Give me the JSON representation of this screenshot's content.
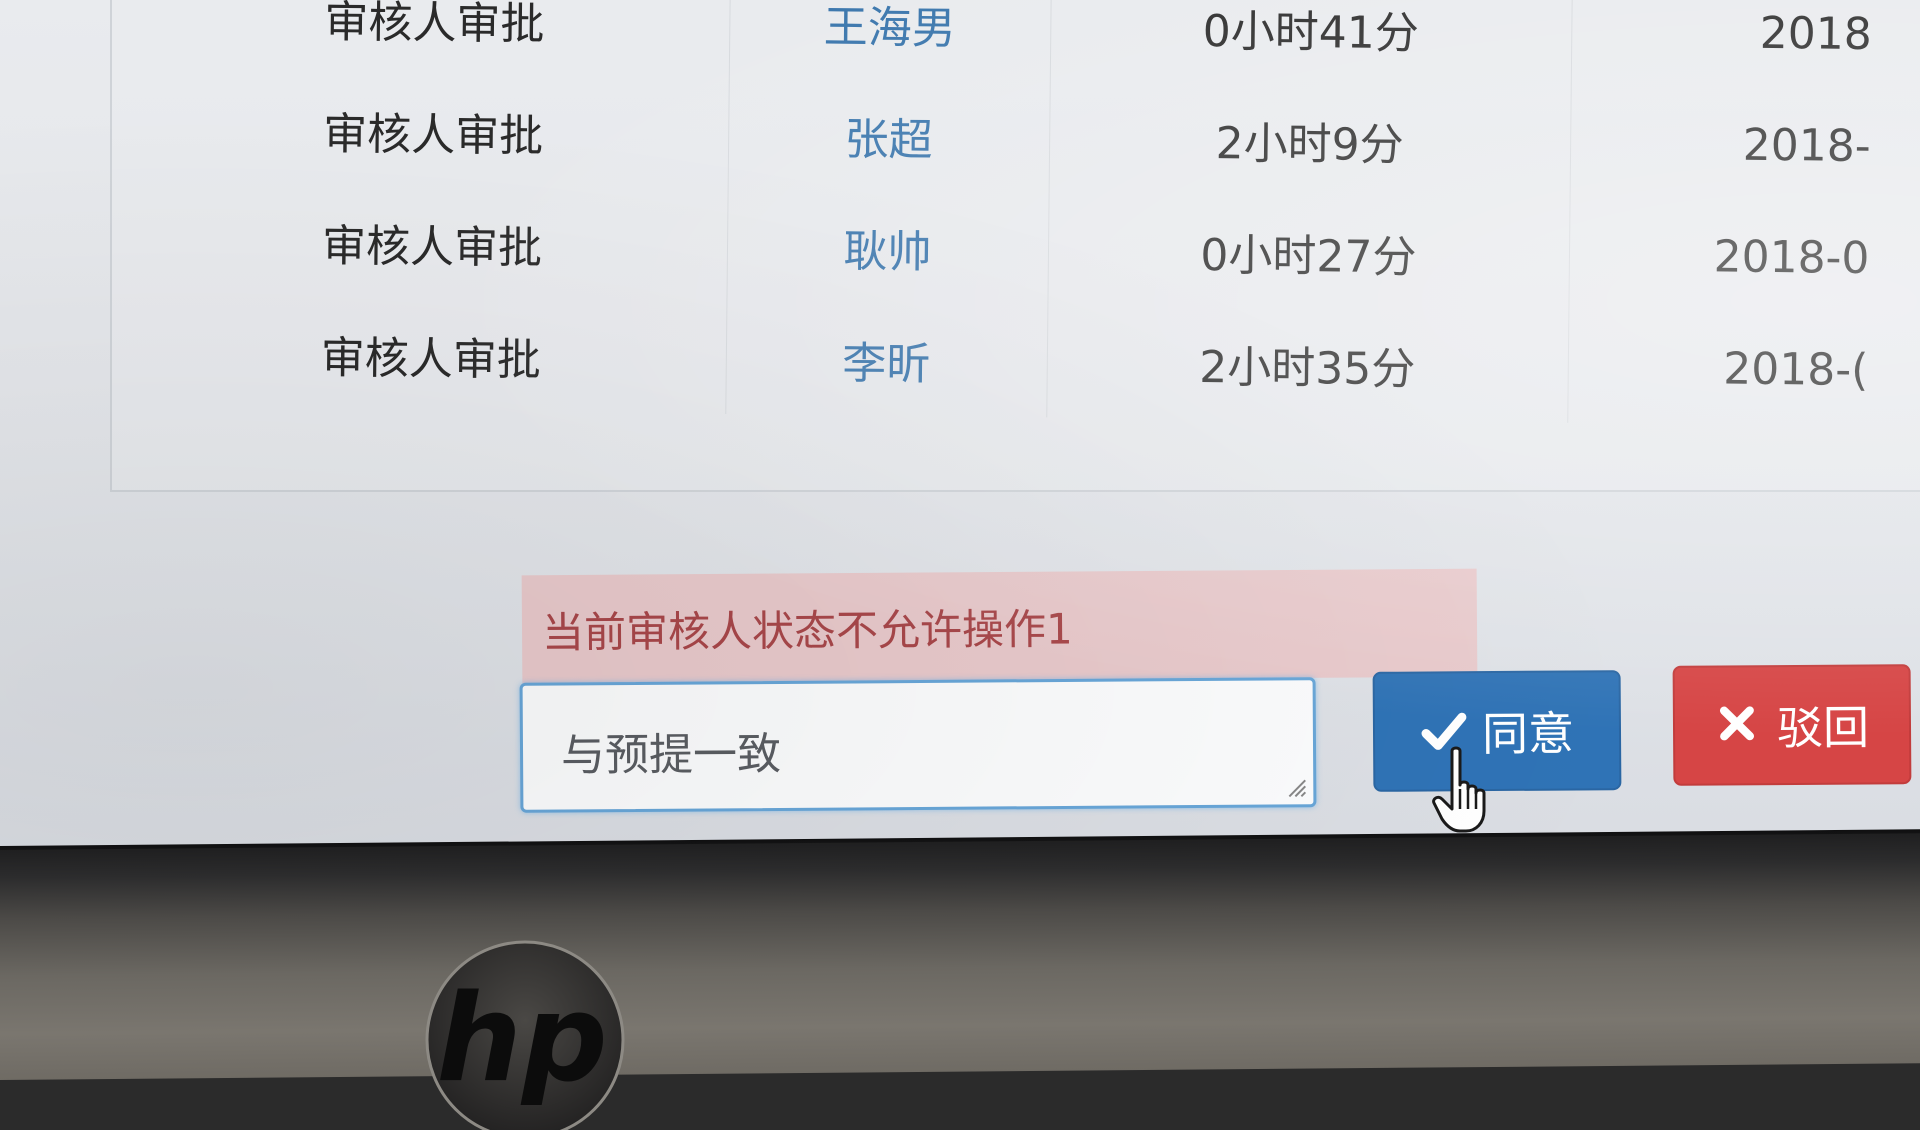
{
  "approval_rows": [
    {
      "step": "审核人审批",
      "user": "王海男",
      "duration": "0小时41分",
      "date": "2018"
    },
    {
      "step": "审核人审批",
      "user": "张超",
      "duration": "2小时9分",
      "date": "2018-"
    },
    {
      "step": "审核人审批",
      "user": "耿帅",
      "duration": "0小时27分",
      "date": "2018-0"
    },
    {
      "step": "审核人审批",
      "user": "李昕",
      "duration": "2小时35分",
      "date": "2018-("
    }
  ],
  "alert": {
    "message": "当前审核人状态不允许操作1"
  },
  "comment": {
    "value": "与预提一致"
  },
  "actions": {
    "approve_label": "同意",
    "reject_label": "驳回"
  },
  "colors": {
    "approve": "#2f73b6",
    "reject": "#d64545",
    "alert_bg": "#e8c9cb",
    "alert_text": "#a8474a",
    "link": "#3c77ad"
  },
  "icons": {
    "approve": "check-icon",
    "reject": "x-icon",
    "cursor": "hand-pointer-icon",
    "logo": "hp-logo"
  },
  "device": {
    "logo_text": "hp"
  }
}
